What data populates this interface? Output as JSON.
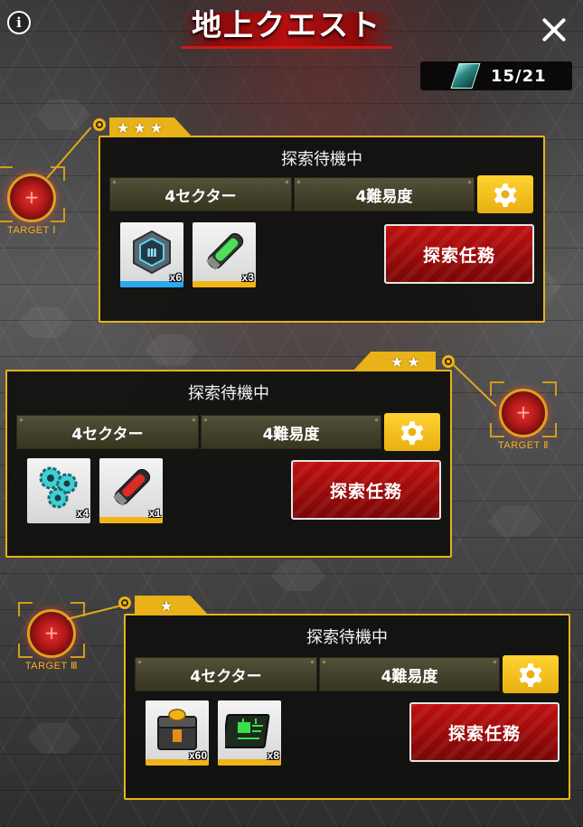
{
  "header": {
    "title": "地上クエスト",
    "counter": "15/21"
  },
  "colors": {
    "accent_gold": "#e8b218",
    "button_red": "#9a0a0a",
    "target_orange": "#ffb020",
    "rarity_blue": "#2aa8f0",
    "rarity_gold": "#f0b418"
  },
  "icons": {
    "info": "info-icon",
    "close": "close-icon",
    "ticket": "ticket-icon",
    "settings": "gear-icon",
    "star": "star-icon"
  },
  "quests": [
    {
      "target_label": "TARGET Ⅰ",
      "stars": "★★★",
      "star_count": 3,
      "status": "探索待機中",
      "sector": "4セクター",
      "difficulty": "4難易度",
      "button_label": "探索任務",
      "rewards": [
        {
          "name": "hex-chip",
          "qty": "x6",
          "rarity": "blue"
        },
        {
          "name": "green-capsule",
          "qty": "x3",
          "rarity": "gold"
        }
      ]
    },
    {
      "target_label": "TARGET Ⅱ",
      "stars": "★★",
      "star_count": 2,
      "status": "探索待機中",
      "sector": "4セクター",
      "difficulty": "4難易度",
      "button_label": "探索任務",
      "rewards": [
        {
          "name": "gear-parts",
          "qty": "x4",
          "rarity": "none"
        },
        {
          "name": "red-capsule",
          "qty": "x1",
          "rarity": "gold"
        }
      ]
    },
    {
      "target_label": "TARGET Ⅲ",
      "stars": "★",
      "star_count": 1,
      "status": "探索待機中",
      "sector": "4セクター",
      "difficulty": "4難易度",
      "button_label": "探索任務",
      "rewards": [
        {
          "name": "supply-crate",
          "qty": "x60",
          "rarity": "gold"
        },
        {
          "name": "circuit-board",
          "qty": "x8",
          "rarity": "gold"
        }
      ]
    }
  ]
}
